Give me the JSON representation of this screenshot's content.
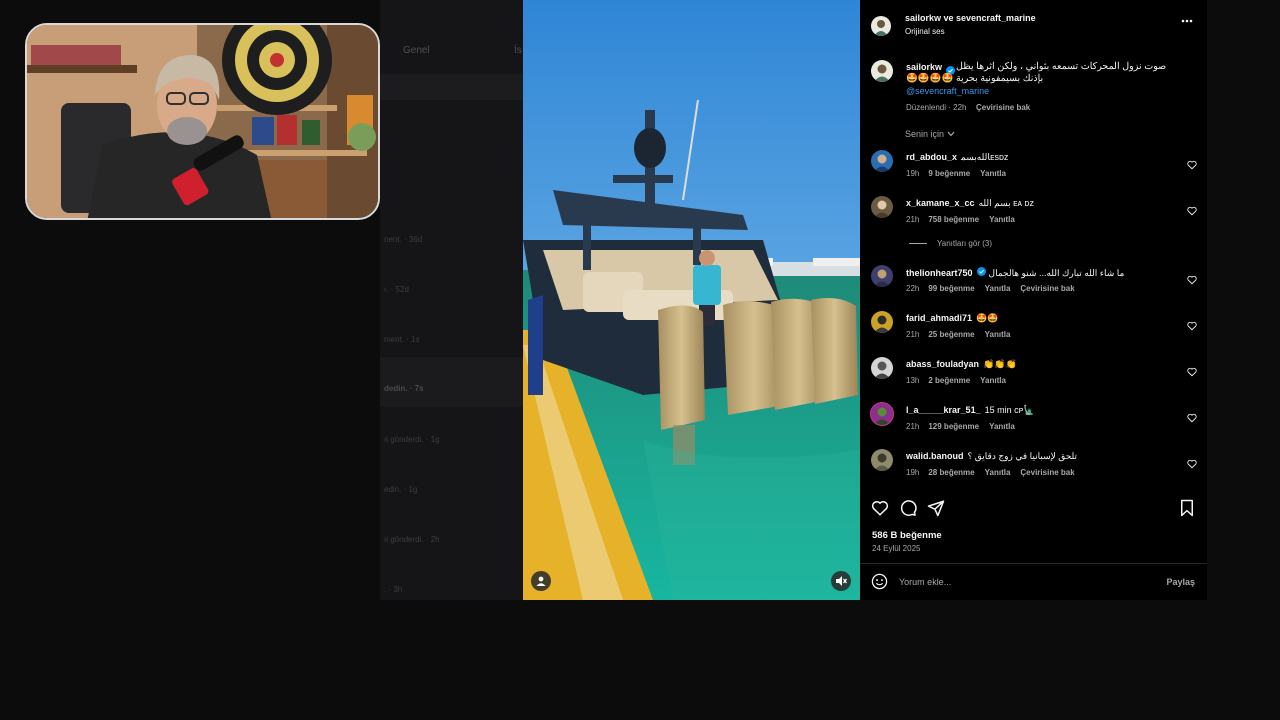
{
  "background_app": {
    "tabs": [
      "Genel",
      "İs"
    ],
    "rows": [
      "nent. · 36d",
      "ı. · 52d",
      "ment. · 1s",
      "dedin. · 7s",
      "ıi gönderdi. · 1g",
      "edin. · 1g",
      "ıi gönderdi. · 2h",
      ". · 3h"
    ]
  },
  "post": {
    "header": {
      "authors": "sailorkw ve sevencraft_marine",
      "audio": "Orijinal ses",
      "more_icon": "more-horizontal-icon"
    },
    "caption": {
      "username": "sailorkw",
      "verified": true,
      "text_line1": "صوت نزول المحركات تسمعه بثواني ، ولكن اثرها يظل",
      "text_line2": "بإذنك بسيمفونية بحرية 🤩🤩🤩🤩",
      "mention": "@sevencraft_marine",
      "edited": "Düzenlendi · 22h",
      "translate": "Çevirisine bak"
    },
    "sort_label": "Senin için",
    "comments": [
      {
        "username": "rd_abdou_x",
        "verified": false,
        "text": "بسم‎الله‎ᴇѕᴅᴢ",
        "time": "19h",
        "likes": "9 beğenme",
        "reply": "Yanıtla",
        "translate": "",
        "avatar_color": "#2a6db0"
      },
      {
        "username": "x_kamane_x_cc",
        "verified": false,
        "text": "بسم الله ᴇᴀ ᴅᴢ",
        "time": "21h",
        "likes": "758 beğenme",
        "reply": "Yanıtla",
        "translate": "",
        "avatar_color": "#6b5a44"
      },
      {
        "username": "thelionheart750",
        "verified": true,
        "text": "ما شاء الله تبارك الله... شنو هالجمال",
        "time": "22h",
        "likes": "99 beğenme",
        "reply": "Yanıtla",
        "translate": "Çevirisine bak",
        "avatar_color": "#3d3f6e"
      },
      {
        "username": "farid_ahmadi71",
        "verified": false,
        "text": "🤩🤩",
        "time": "21h",
        "likes": "25 beğenme",
        "reply": "Yanıtla",
        "translate": "",
        "avatar_color": "#c9a227"
      },
      {
        "username": "abass_fouladyan",
        "verified": false,
        "text": "👏👏👏",
        "time": "13h",
        "likes": "2 beğenme",
        "reply": "Yanıtla",
        "translate": "",
        "avatar_color": "#d5d5d5"
      },
      {
        "username": "l_a_____krar_51_",
        "verified": false,
        "text": "15 min ᴄᴘ🗽",
        "time": "21h",
        "likes": "129 beğenme",
        "reply": "Yanıtla",
        "translate": "",
        "avatar_color": "#8a2f8a"
      },
      {
        "username": "walid.banoud",
        "verified": false,
        "text": "تلحق لإسبانيا في زوج دقايق ؟",
        "time": "19h",
        "likes": "28 beğenme",
        "reply": "Yanıtla",
        "translate": "Çevirisine bak",
        "avatar_color": "#8f8a6a"
      }
    ],
    "replies_toggle": "Yanıtları gör (3)",
    "like_count": "586 B beğenme",
    "date": "24 Eylül 2025",
    "comment_placeholder": "Yorum ekle...",
    "share_label": "Paylaş",
    "colors": {
      "accent": "#0095f6",
      "text": "#f5f5f5",
      "muted": "#a8a8a8",
      "background": "#000000"
    }
  }
}
